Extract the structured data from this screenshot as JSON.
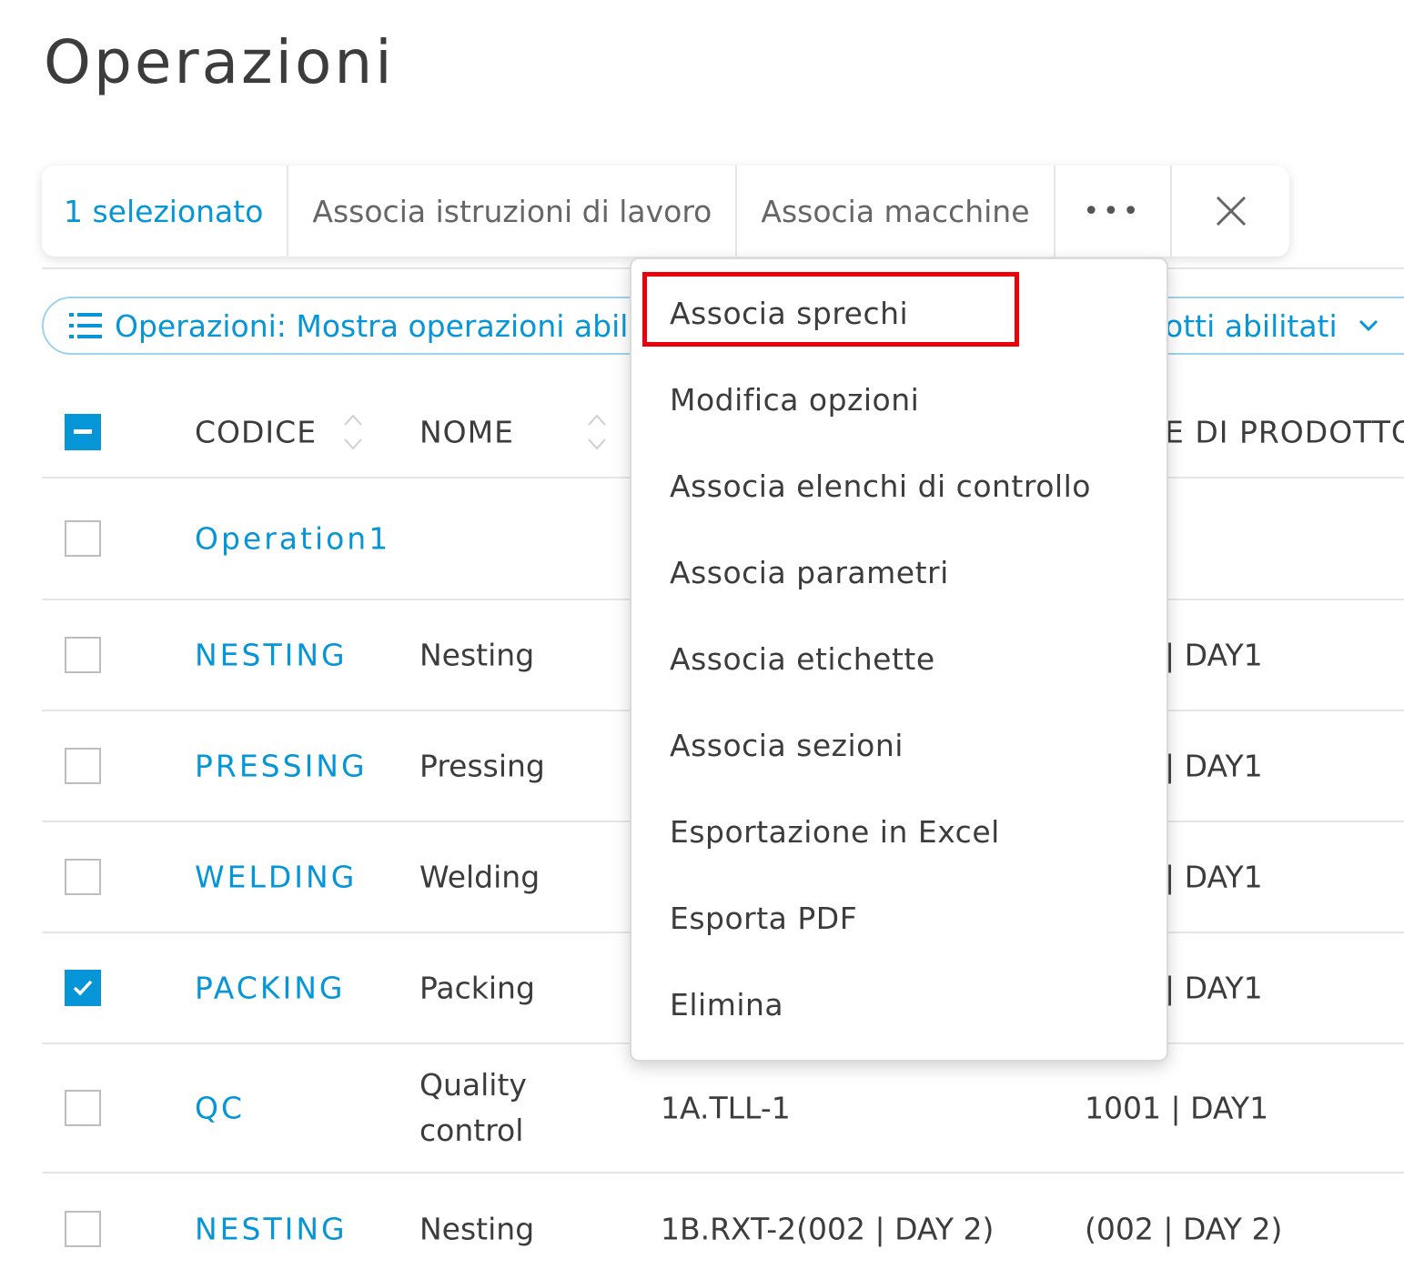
{
  "page": {
    "title": "Operazioni"
  },
  "action_bar": {
    "selected_count": "1 selezionato",
    "associate_work_instructions": "Associa istruzioni di lavoro",
    "associate_machines": "Associa macchine",
    "more_label": "•••",
    "close_icon": "close-icon"
  },
  "filters": {
    "operations_filter": "Operazioni: Mostra operazioni abil",
    "products_filter": "otti abilitati"
  },
  "table": {
    "headers": {
      "code": "CODICE",
      "name": "NOME",
      "col4": "E DI PRODOTTO"
    },
    "rows": [
      {
        "code": "Operation1",
        "name": "",
        "col3": "",
        "col4": "",
        "checked": false
      },
      {
        "code": "NESTING",
        "name": "Nesting",
        "col3": "",
        "col4": "| DAY1",
        "checked": false
      },
      {
        "code": "PRESSING",
        "name": "Pressing",
        "col3": "",
        "col4": "| DAY1",
        "checked": false
      },
      {
        "code": "WELDING",
        "name": "Welding",
        "col3": "",
        "col4": "| DAY1",
        "checked": false
      },
      {
        "code": "PACKING",
        "name": "Packing",
        "col3": "",
        "col4": "| DAY1",
        "checked": true
      },
      {
        "code": "QC",
        "name": "Quality control",
        "col3": "1A.TLL-1",
        "col4": "1001 | DAY1",
        "checked": false
      },
      {
        "code": "NESTING",
        "name": "Nesting",
        "col3": "1B.RXT-2(002 | DAY 2)",
        "col4": "(002 | DAY 2)",
        "checked": false
      }
    ]
  },
  "menu": {
    "items": [
      "Associa sprechi",
      "Modifica opzioni",
      "Associa elenchi di controllo",
      "Associa parametri",
      "Associa etichette",
      "Associa sezioni",
      "Esportazione in Excel",
      "Esporta PDF",
      "Elimina"
    ],
    "highlighted_index": 0
  },
  "colors": {
    "accent": "#0696d7",
    "text": "#3c3c3c",
    "highlight": "#e8000b"
  }
}
